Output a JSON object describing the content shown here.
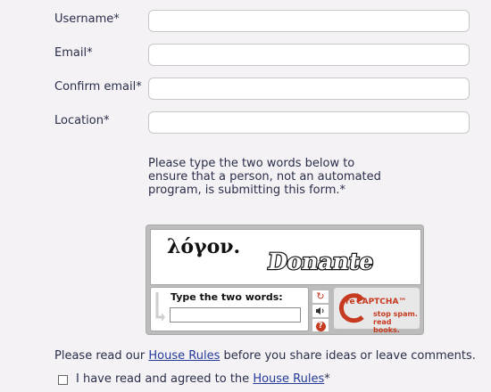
{
  "form": {
    "username_label": "Username*",
    "email_label": "Email*",
    "confirm_email_label": "Confirm email*",
    "location_label": "Location*",
    "note": "Please type the two words below to ensure that a person, not an automated program, is submitting this form.*"
  },
  "captcha": {
    "word1": "λόγον.",
    "word2": "Donante",
    "prompt": "Type the two words:",
    "brand_re": "re",
    "brand_name": "CAPTCHA™",
    "tagline1": "stop spam.",
    "tagline2": "read books.",
    "icons": [
      "refresh-icon",
      "audio-icon",
      "help-icon"
    ]
  },
  "footer": {
    "rules_prefix": "Please read our ",
    "rules_link": "House Rules",
    "rules_suffix": " before you share ideas or leave comments."
  },
  "agree": {
    "prefix": "I have read and agreed to the ",
    "link": "House Rules",
    "suffix": "*"
  },
  "colors": {
    "background": "#f4f2f4",
    "text": "#2a2e4a",
    "link": "#243a9a",
    "recaptcha_red": "#c63a20"
  }
}
